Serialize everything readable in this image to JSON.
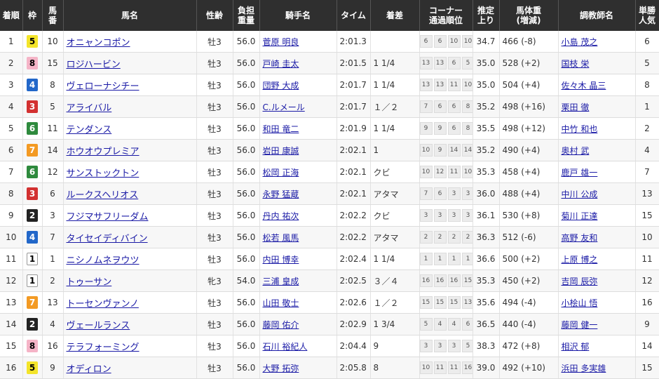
{
  "headers": {
    "rank": "着順",
    "waku": "枠",
    "umaban": [
      "馬",
      "番"
    ],
    "horse": "馬名",
    "sexage": "性齢",
    "weight": [
      "負担",
      "重量"
    ],
    "jockey": "騎手名",
    "time": "タイム",
    "margin": "着差",
    "corner": [
      "コーナー",
      "通過順位"
    ],
    "agari": [
      "推定",
      "上り"
    ],
    "bodyweight": [
      "馬体重",
      "(増減)"
    ],
    "trainer": "調教師名",
    "popularity": [
      "単勝",
      "人気"
    ]
  },
  "waku_colors": {
    "1": "#ffffff",
    "2": "#222222",
    "3": "#d33131",
    "4": "#2267c9",
    "5": "#f3e42a",
    "6": "#2e8a3d",
    "7": "#f39a23",
    "8": "#f5b4c7"
  },
  "rows": [
    {
      "rank": "1",
      "waku": "5",
      "umaban": "10",
      "horse": "オニャンコポン",
      "sexage": "牡3",
      "weight": "56.0",
      "jockey": "菅原 明良",
      "time": "2:01.3",
      "margin": "",
      "corners": [
        "6",
        "6",
        "10",
        "10"
      ],
      "agari": "34.7",
      "bodyweight": "466 (-8)",
      "trainer": "小島 茂之",
      "popularity": "6"
    },
    {
      "rank": "2",
      "waku": "8",
      "umaban": "15",
      "horse": "ロジハービン",
      "sexage": "牡3",
      "weight": "56.0",
      "jockey": "戸崎 圭太",
      "time": "2:01.5",
      "margin": "1 1/4",
      "corners": [
        "13",
        "13",
        "6",
        "5"
      ],
      "agari": "35.0",
      "bodyweight": "528 (+2)",
      "trainer": "国枝 栄",
      "popularity": "5"
    },
    {
      "rank": "3",
      "waku": "4",
      "umaban": "8",
      "horse": "ヴェローナシチー",
      "sexage": "牡3",
      "weight": "56.0",
      "jockey": "団野 大成",
      "time": "2:01.7",
      "margin": "1 1/4",
      "corners": [
        "13",
        "13",
        "11",
        "10"
      ],
      "agari": "35.0",
      "bodyweight": "504 (+4)",
      "trainer": "佐々木 晶三",
      "popularity": "8"
    },
    {
      "rank": "4",
      "waku": "3",
      "umaban": "5",
      "horse": "アライバル",
      "sexage": "牡3",
      "weight": "56.0",
      "jockey": "C.ルメール",
      "time": "2:01.7",
      "margin": "１／２",
      "corners": [
        "7",
        "6",
        "6",
        "8"
      ],
      "agari": "35.2",
      "bodyweight": "498 (+16)",
      "trainer": "栗田 徹",
      "popularity": "1"
    },
    {
      "rank": "5",
      "waku": "6",
      "umaban": "11",
      "horse": "テンダンス",
      "sexage": "牡3",
      "weight": "56.0",
      "jockey": "和田 竜二",
      "time": "2:01.9",
      "margin": "1 1/4",
      "corners": [
        "9",
        "9",
        "6",
        "8"
      ],
      "agari": "35.5",
      "bodyweight": "498 (+12)",
      "trainer": "中竹 和也",
      "popularity": "2"
    },
    {
      "rank": "6",
      "waku": "7",
      "umaban": "14",
      "horse": "ホウオウプレミア",
      "sexage": "牡3",
      "weight": "56.0",
      "jockey": "岩田 康誠",
      "time": "2:02.1",
      "margin": "1",
      "corners": [
        "10",
        "9",
        "14",
        "14"
      ],
      "agari": "35.2",
      "bodyweight": "490 (+4)",
      "trainer": "奥村 武",
      "popularity": "4"
    },
    {
      "rank": "7",
      "waku": "6",
      "umaban": "12",
      "horse": "サンストックトン",
      "sexage": "牡3",
      "weight": "56.0",
      "jockey": "松岡 正海",
      "time": "2:02.1",
      "margin": "クビ",
      "corners": [
        "10",
        "12",
        "11",
        "10"
      ],
      "agari": "35.3",
      "bodyweight": "458 (+4)",
      "trainer": "鹿戸 雄一",
      "popularity": "7"
    },
    {
      "rank": "8",
      "waku": "3",
      "umaban": "6",
      "horse": "ルークスヘリオス",
      "sexage": "牡3",
      "weight": "56.0",
      "jockey": "永野 猛蔵",
      "time": "2:02.1",
      "margin": "アタマ",
      "corners": [
        "7",
        "6",
        "3",
        "3"
      ],
      "agari": "36.0",
      "bodyweight": "488 (+4)",
      "trainer": "中川 公成",
      "popularity": "13"
    },
    {
      "rank": "9",
      "waku": "2",
      "umaban": "3",
      "horse": "フジマサフリーダム",
      "sexage": "牡3",
      "weight": "56.0",
      "jockey": "丹内 祐次",
      "time": "2:02.2",
      "margin": "クビ",
      "corners": [
        "3",
        "3",
        "3",
        "3"
      ],
      "agari": "36.1",
      "bodyweight": "530 (+8)",
      "trainer": "菊川 正達",
      "popularity": "15"
    },
    {
      "rank": "10",
      "waku": "4",
      "umaban": "7",
      "horse": "タイセイディバイン",
      "sexage": "牡3",
      "weight": "56.0",
      "jockey": "松若 風馬",
      "time": "2:02.2",
      "margin": "アタマ",
      "corners": [
        "2",
        "2",
        "2",
        "2"
      ],
      "agari": "36.3",
      "bodyweight": "512 (-6)",
      "trainer": "高野 友和",
      "popularity": "10"
    },
    {
      "rank": "11",
      "waku": "1",
      "umaban": "1",
      "horse": "ニシノムネヲウツ",
      "sexage": "牡3",
      "weight": "56.0",
      "jockey": "内田 博幸",
      "time": "2:02.4",
      "margin": "1 1/4",
      "corners": [
        "1",
        "1",
        "1",
        "1"
      ],
      "agari": "36.6",
      "bodyweight": "500 (+2)",
      "trainer": "上原 博之",
      "popularity": "11"
    },
    {
      "rank": "12",
      "waku": "1",
      "umaban": "2",
      "horse": "トゥーサン",
      "sexage": "牝3",
      "weight": "54.0",
      "jockey": "三浦 皇成",
      "time": "2:02.5",
      "margin": "３／４",
      "corners": [
        "16",
        "16",
        "16",
        "15"
      ],
      "agari": "35.3",
      "bodyweight": "450 (+2)",
      "trainer": "吉岡 辰弥",
      "popularity": "12"
    },
    {
      "rank": "13",
      "waku": "7",
      "umaban": "13",
      "horse": "トーセンヴァンノ",
      "sexage": "牡3",
      "weight": "56.0",
      "jockey": "山田 敬士",
      "time": "2:02.6",
      "margin": "１／２",
      "corners": [
        "15",
        "15",
        "15",
        "13"
      ],
      "agari": "35.6",
      "bodyweight": "494 (-4)",
      "trainer": "小桧山 悟",
      "popularity": "16"
    },
    {
      "rank": "14",
      "waku": "2",
      "umaban": "4",
      "horse": "ヴェールランス",
      "sexage": "牡3",
      "weight": "56.0",
      "jockey": "藤岡 佑介",
      "time": "2:02.9",
      "margin": "1 3/4",
      "corners": [
        "5",
        "4",
        "4",
        "6"
      ],
      "agari": "36.5",
      "bodyweight": "440 (-4)",
      "trainer": "藤岡 健一",
      "popularity": "9"
    },
    {
      "rank": "15",
      "waku": "8",
      "umaban": "16",
      "horse": "テラフォーミング",
      "sexage": "牡3",
      "weight": "56.0",
      "jockey": "石川 裕紀人",
      "time": "2:04.4",
      "margin": "9",
      "corners": [
        "3",
        "3",
        "3",
        "5"
      ],
      "agari": "38.3",
      "bodyweight": "472 (+8)",
      "trainer": "相沢 郁",
      "popularity": "14"
    },
    {
      "rank": "16",
      "waku": "5",
      "umaban": "9",
      "horse": "オディロン",
      "sexage": "牡3",
      "weight": "56.0",
      "jockey": "大野 拓弥",
      "time": "2:05.8",
      "margin": "8",
      "corners": [
        "10",
        "11",
        "11",
        "16"
      ],
      "agari": "39.0",
      "bodyweight": "492 (+10)",
      "trainer": "浜田 多実雄",
      "popularity": "15"
    }
  ]
}
